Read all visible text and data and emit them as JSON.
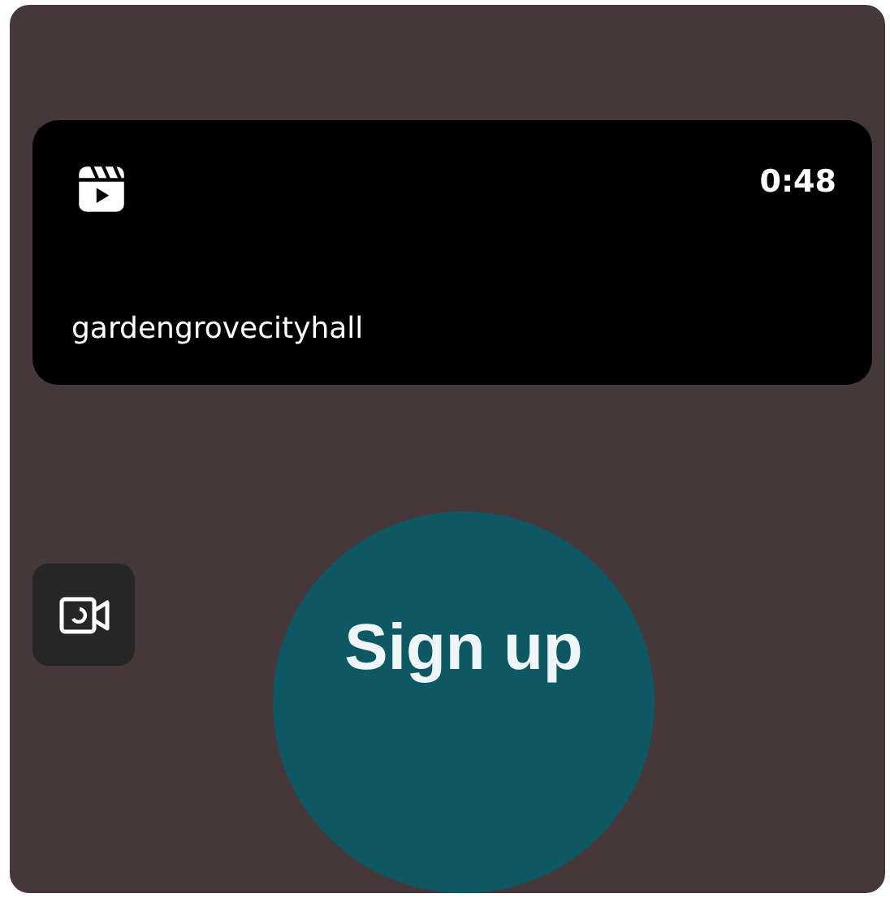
{
  "video": {
    "duration": "0:48",
    "username": "gardengrovecityhall"
  },
  "sign_up": {
    "label": "Sign up"
  }
}
